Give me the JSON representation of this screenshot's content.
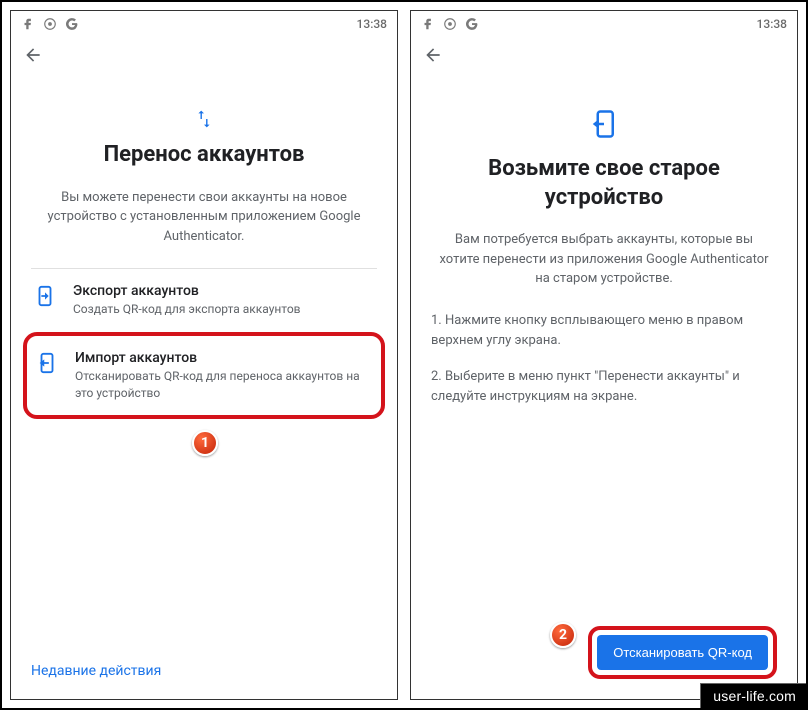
{
  "status": {
    "time": "13:38"
  },
  "screen1": {
    "title": "Перенос аккаунтов",
    "desc": "Вы можете перенести свои аккаунты на новое устройство с установленным приложением Google Authenticator.",
    "export": {
      "title": "Экспорт аккаунтов",
      "sub": "Создать QR-код для экспорта аккаунтов"
    },
    "import": {
      "title": "Импорт аккаунтов",
      "sub": "Отсканировать QR-код для переноса аккаунтов на это устройство"
    },
    "recent": "Недавние действия"
  },
  "screen2": {
    "title": "Возьмите свое старое устройство",
    "desc": "Вам потребуется выбрать аккаунты, которые вы хотите перенести из приложения Google Authenticator на старом устройстве.",
    "step1": "1. Нажмите кнопку всплывающего меню в правом верхнем углу экрана.",
    "step2": "2. Выберите в меню пункт \"Перенести аккаунты\" и следуйте инструкциям на экране.",
    "cta": "Отсканировать QR-код"
  },
  "badges": {
    "b1": "1",
    "b2": "2"
  },
  "watermark": "user-life.com"
}
